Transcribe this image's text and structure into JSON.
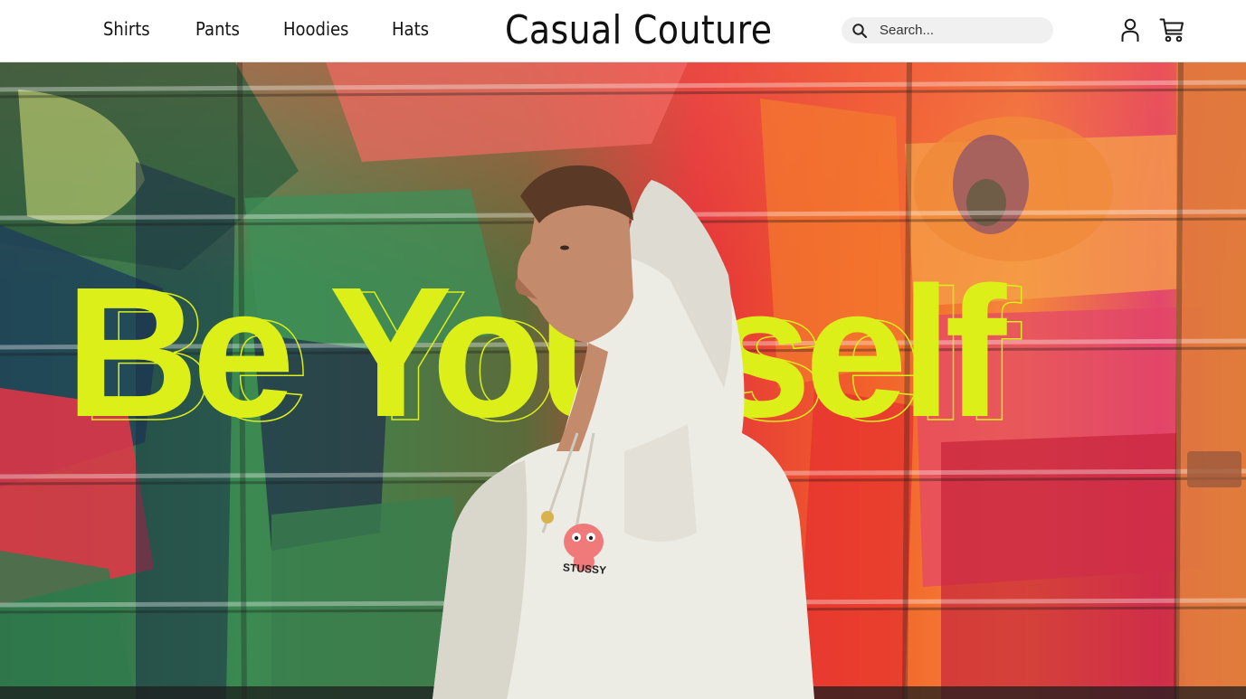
{
  "nav": {
    "items": [
      {
        "label": "Shirts"
      },
      {
        "label": "Pants"
      },
      {
        "label": "Hoodies"
      },
      {
        "label": "Hats"
      }
    ]
  },
  "brand": {
    "name": "Casual Couture"
  },
  "search": {
    "placeholder": "Search...",
    "value": ""
  },
  "header_icons": {
    "account": "user-icon",
    "cart": "shopping-cart-icon",
    "search": "search-icon"
  },
  "hero": {
    "title": "Be Yourself",
    "hoodie_print": "STUSSY",
    "accent_color": "#dcef19"
  }
}
